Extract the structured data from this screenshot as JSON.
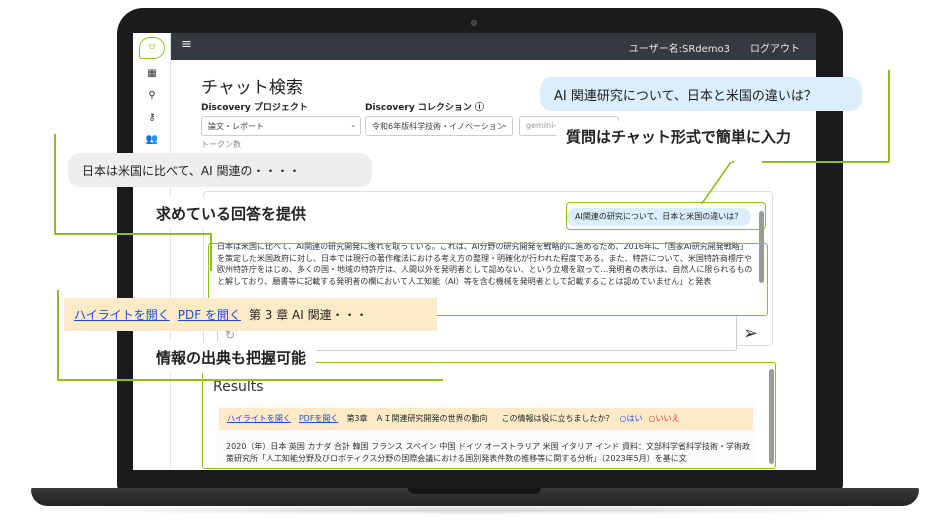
{
  "topbar": {
    "user": "ユーザー名:SRdemo3",
    "logout": "ログアウト"
  },
  "page": {
    "title": "チャット検索",
    "token_label": "トークン数"
  },
  "filters": {
    "project_label": "Discovery プロジェクト",
    "project_value": "論文・レポート",
    "collection_label": "Discovery コレクション ⓘ",
    "collection_value": "令和6年版科学技術・イノベーション",
    "model_value": "gemini-1.5-flash"
  },
  "chat": {
    "question": "AI関連の研究について、日本と米国の違いは？",
    "answer": "日本は米国に比べて、AI関連の研究開発に後れを取っている。これは、AI分野の研究開発を戦略的に進めるため、2016年に「国家AI研究開発戦略」を策定した米国政府に対し、日本では現行の著作権法における考え方の整理・明確化が行われた程度である。また、特許について、米国特許商標庁や欧州特許庁をはじめ、多くの国・地域の特許庁は、人間以外を発明者として認めない、という立場を取って…発明者の表示は、自然人に限られるものと解しており、願書等に記載する発明者の欄において人工知能（AI）等を含む機械を発明者として記載することは認めていません」と発表"
  },
  "results": {
    "heading": "Results",
    "highlight_link": "ハイライトを開く",
    "pdf_link": "PDFを開く",
    "chapter": "第3章　ＡＩ関連研究開発の世界の動向",
    "helpful_q": "この情報は役に立ちましたか？",
    "yes": "○はい",
    "no": "○いいえ",
    "body": "2020（年）日本 英国 カナダ 合計 韓国 フランス スペイン 中国 ドイツ オーストラリア 米国 イタリア インド 資料：文部科学省科学技術・学術政策研究所「人工知能分野及びロボティクス分野の国際会議における国別発表件数の推移等に関する分析」（2023年5月）を基に文"
  },
  "callouts": {
    "question_bubble": "AI 関連研究について、日本と米国の違いは？",
    "question_caption": "質問はチャット形式で簡単に入力",
    "answer_bubble": "日本は米国に比べて、AI 関連の・・・・",
    "answer_caption": "求めている回答を提供",
    "source_highlight": "ハイライトを開く",
    "source_pdf": "PDF を開く",
    "source_chapter": "第 3 章 AI 関連・・・",
    "source_caption": "情報の出典も把握可能"
  },
  "colors": {
    "accent": "#8fbf1e",
    "topbar": "#343a40",
    "question_bg": "#dbeefb",
    "result_bg": "#fdebc8",
    "link": "#1a4fd6",
    "no": "#d23b1f"
  }
}
